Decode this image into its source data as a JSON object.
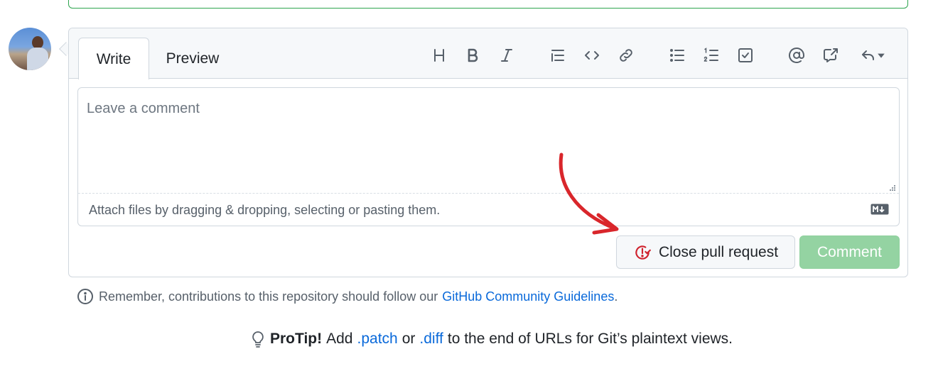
{
  "tabs": {
    "write": "Write",
    "preview": "Preview"
  },
  "toolbar": {
    "icons": [
      "heading-icon",
      "bold-icon",
      "italic-icon",
      "quote-icon",
      "code-icon",
      "link-icon",
      "bulleted-list-icon",
      "numbered-list-icon",
      "task-list-icon",
      "mention-icon",
      "cross-reference-icon",
      "reply-icon"
    ]
  },
  "editor": {
    "placeholder": "Leave a comment",
    "attach_text": "Attach files by dragging & dropping, selecting or pasting them.",
    "markdown_badge": "M↓"
  },
  "actions": {
    "close_label": "Close pull request",
    "comment_label": "Comment"
  },
  "reminder": {
    "text": "Remember, contributions to this repository should follow our",
    "link": "GitHub Community Guidelines",
    "period": "."
  },
  "protip": {
    "label": "ProTip!",
    "part1": "Add",
    "patch": ".patch",
    "part2": "or",
    "diff": ".diff",
    "part3": "to the end of URLs for Git’s plaintext views."
  },
  "colors": {
    "close_icon": "#cf222e",
    "comment_button_disabled": "#94d3a2",
    "link": "#0969da",
    "annotation_arrow": "#d9262b"
  }
}
